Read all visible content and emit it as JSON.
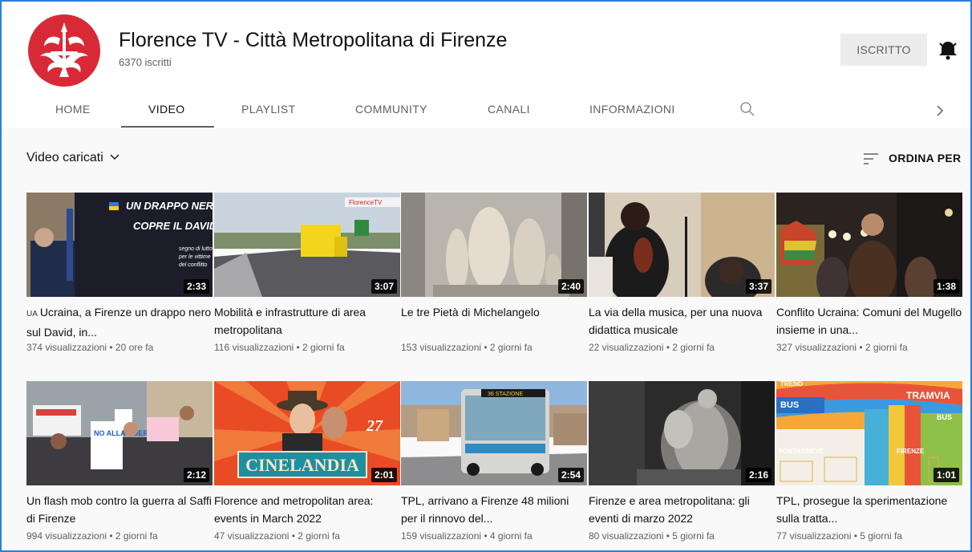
{
  "channel": {
    "title": "Florence TV - Città Metropolitana di Firenze",
    "subscribers": "6370 iscritti",
    "subscribe_label": "ISCRITTO",
    "brand_color": "#d72a36"
  },
  "tabs": [
    {
      "label": "HOME",
      "active": false
    },
    {
      "label": "VIDEO",
      "active": true
    },
    {
      "label": "PLAYLIST",
      "active": false
    },
    {
      "label": "COMMUNITY",
      "active": false
    },
    {
      "label": "CANALI",
      "active": false
    },
    {
      "label": "INFORMAZIONI",
      "active": false
    }
  ],
  "filter": {
    "label": "Video caricati"
  },
  "sort": {
    "label": "ORDINA PER"
  },
  "videos": [
    {
      "tag": "UA",
      "title": "Ucraina, a Firenze un drappo nero sul David, in...",
      "meta": "374 visualizzazioni • 20 ore fa",
      "duration": "2:33",
      "thumb_text": [
        "UN DRAPPO NERO",
        "COPRE IL DAVID",
        "segno di lutto",
        "per le vittime",
        "del conflitto"
      ]
    },
    {
      "tag": "",
      "title": "Mobilità e infrastrutture di area metropolitana",
      "meta": "116 visualizzazioni • 2 giorni fa",
      "duration": "3:07",
      "thumb_text": [
        "FlorenceTV"
      ]
    },
    {
      "tag": "",
      "title": "Le tre Pietà di Michelangelo",
      "meta": "153 visualizzazioni • 2 giorni fa",
      "duration": "2:40",
      "thumb_text": []
    },
    {
      "tag": "",
      "title": "La via della musica, per una nuova didattica musicale",
      "meta": "22 visualizzazioni • 2 giorni fa",
      "duration": "3:37",
      "thumb_text": []
    },
    {
      "tag": "",
      "title": "Conflito Ucraina: Comuni del Mugello insieme in una...",
      "meta": "327 visualizzazioni • 2 giorni fa",
      "duration": "1:38",
      "thumb_text": []
    },
    {
      "tag": "",
      "title": "Un flash mob contro la guerra al Saffi di Firenze",
      "meta": "994 visualizzazioni • 2 giorni fa",
      "duration": "2:12",
      "thumb_text": [
        "NO ALLA GUERRA"
      ]
    },
    {
      "tag": "",
      "title": "Florence and metropolitan area: events in March 2022",
      "meta": "47 visualizzazioni • 2 giorni fa",
      "duration": "2:01",
      "thumb_text": [
        "CINELANDIA",
        "27"
      ]
    },
    {
      "tag": "",
      "title": "TPL, arrivano a Firenze 48 milioni per il rinnovo del...",
      "meta": "159 visualizzazioni • 4 giorni fa",
      "duration": "2:54",
      "thumb_text": [
        "36 STAZIONE"
      ]
    },
    {
      "tag": "",
      "title": "Firenze e area metropolitana: gli eventi di marzo 2022",
      "meta": "80 visualizzazioni • 5 giorni fa",
      "duration": "2:16",
      "thumb_text": []
    },
    {
      "tag": "",
      "title": "TPL, prosegue la sperimentazione sulla tratta...",
      "meta": "77 visualizzazioni • 5 giorni fa",
      "duration": "1:01",
      "thumb_text": [
        "TRENO",
        "BUS",
        "TRAMVIA",
        "BUS",
        "PONTASSIEVE",
        "FIRENZE"
      ]
    }
  ]
}
